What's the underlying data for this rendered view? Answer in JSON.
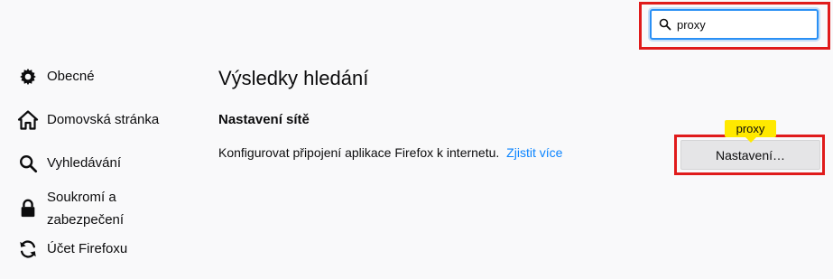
{
  "search": {
    "value": "proxy",
    "icon": "search-icon"
  },
  "sidebar": {
    "items": [
      {
        "label": "Obecné",
        "icon": "gear-icon"
      },
      {
        "label": "Domovská stránka",
        "icon": "home-icon"
      },
      {
        "label": "Vyhledávání",
        "icon": "search-icon"
      },
      {
        "label": "Soukromí a zabezpečení",
        "icon": "lock-icon"
      },
      {
        "label": "Účet Firefoxu",
        "icon": "sync-icon"
      }
    ]
  },
  "main": {
    "title": "Výsledky hledání",
    "section_title": "Nastavení sítě",
    "description": "Konfigurovat připojení aplikace Firefox k internetu.",
    "learn_more": "Zjistit více",
    "highlight_tag": "proxy",
    "settings_button": "Nastavení…"
  },
  "colors": {
    "background": "#f9f9fa",
    "link": "#0a84ff",
    "highlight_border": "#e01b1b",
    "tag": "#ffe900",
    "focus": "#2a90f5"
  }
}
